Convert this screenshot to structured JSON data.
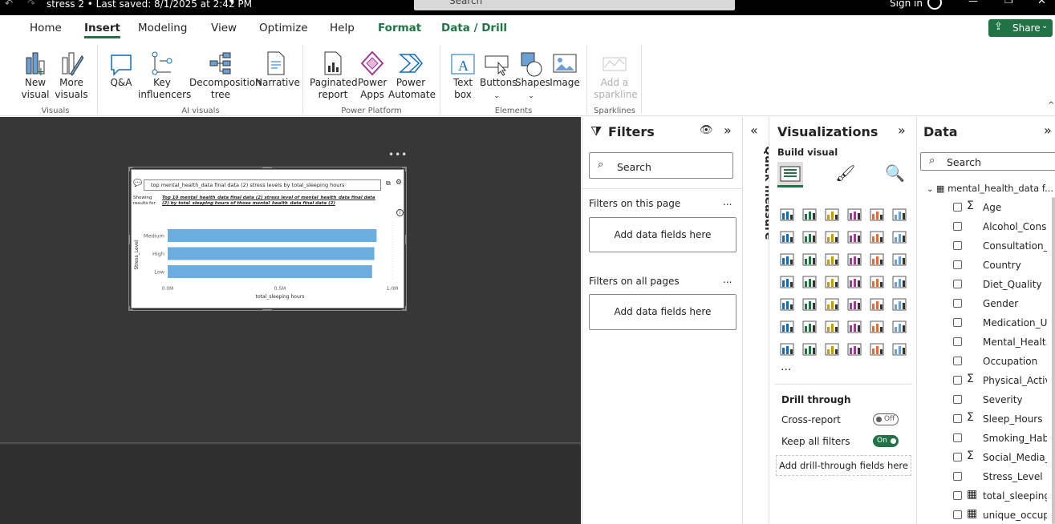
{
  "titlebar": {
    "title": "stress 2 • Last saved: 8/1/2025 at 2:42 PM",
    "search_placeholder": "Search",
    "signin": "Sign in"
  },
  "tabs": [
    {
      "label": "Home"
    },
    {
      "label": "Insert"
    },
    {
      "label": "Modeling"
    },
    {
      "label": "View"
    },
    {
      "label": "Optimize"
    },
    {
      "label": "Help"
    },
    {
      "label": "Format"
    },
    {
      "label": "Data / Drill"
    }
  ],
  "share_label": "Share",
  "ribbon": {
    "visuals": {
      "new_visual": "New\nvisual",
      "more_visuals": "More\nvisuals",
      "group": "Visuals"
    },
    "ai": {
      "qa": "Q&A",
      "key_influencers": "Key\ninfluencers",
      "decomposition": "Decomposition\ntree",
      "narrative": "Narrative",
      "group": "AI visuals"
    },
    "platform": {
      "paginated": "Paginated\nreport",
      "power_apps": "Power\nApps",
      "power_automate": "Power\nAutomate",
      "group": "Power Platform"
    },
    "elements": {
      "text_box": "Text\nbox",
      "buttons": "Buttons",
      "shapes": "Shapes",
      "image": "Image",
      "group": "Elements"
    },
    "sparklines": {
      "add": "Add a\nsparkline",
      "group": "Sparklines"
    }
  },
  "visual": {
    "question": "top mental_health_data final data (2) stress levels by total_sleeping hours",
    "showing_label": "Showing\nresults for",
    "showing_text": "Top 10 mental_health_data final data (2) stress level of mental_health_data final data (2) by total_sleeping hours of those mental_health_data final data (2)",
    "ylabel": "Stress_Level",
    "xlabel": "total_sleeping hours",
    "ticks": [
      "0.0M",
      "0.5M",
      "1.0M"
    ]
  },
  "chart_data": {
    "type": "bar",
    "categories": [
      "Medium",
      "High",
      "Low"
    ],
    "values": [
      0.93,
      0.92,
      0.91
    ],
    "xlabel": "total_sleeping hours",
    "ylabel": "Stress_Level",
    "xlim": [
      0,
      1.0
    ],
    "color": "#6aaee0"
  },
  "filters": {
    "title": "Filters",
    "search": "Search",
    "this_page": "Filters on this page",
    "all_pages": "Filters on all pages",
    "add_fields": "Add data fields here",
    "more": "..."
  },
  "quick_measure": "Quick measure",
  "visualizations": {
    "title": "Visualizations",
    "build": "Build visual",
    "more": "...",
    "drill_through": "Drill through",
    "cross_report": "Cross-report",
    "cross_report_state": "Off",
    "keep_filters": "Keep all filters",
    "keep_filters_state": "On",
    "add_drill": "Add drill-through fields here"
  },
  "data_pane": {
    "title": "Data",
    "search": "Search",
    "table": "mental_health_data f...",
    "fields": [
      {
        "name": "Age",
        "sigma": true
      },
      {
        "name": "Alcohol_Cons...",
        "sigma": false
      },
      {
        "name": "Consultation_...",
        "sigma": false
      },
      {
        "name": "Country",
        "sigma": false
      },
      {
        "name": "Diet_Quality",
        "sigma": false
      },
      {
        "name": "Gender",
        "sigma": false
      },
      {
        "name": "Medication_U...",
        "sigma": false
      },
      {
        "name": "Mental_Healt...",
        "sigma": false
      },
      {
        "name": "Occupation",
        "sigma": false
      },
      {
        "name": "Physical_Activi...",
        "sigma": true
      },
      {
        "name": "Severity",
        "sigma": false
      },
      {
        "name": "Sleep_Hours",
        "sigma": true
      },
      {
        "name": "Smoking_Habit",
        "sigma": false
      },
      {
        "name": "Social_Media_...",
        "sigma": true
      },
      {
        "name": "Stress_Level",
        "sigma": false
      },
      {
        "name": "total_sleeping...",
        "sigma": false,
        "calc": true
      },
      {
        "name": "unique_occup...",
        "sigma": false,
        "calc": true
      }
    ]
  }
}
